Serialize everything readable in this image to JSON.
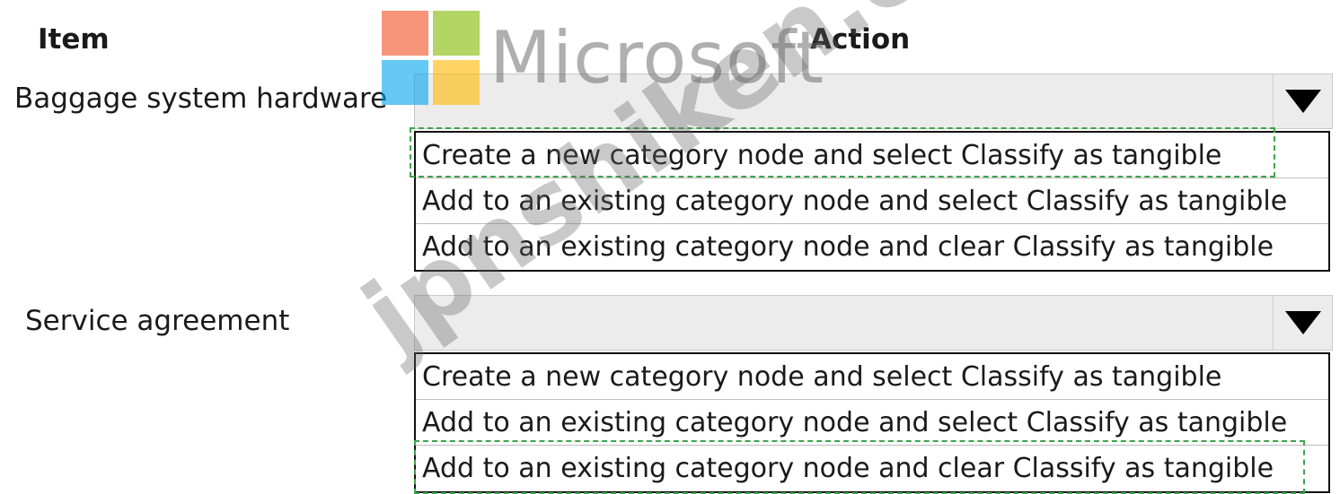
{
  "headers": {
    "item": "Item",
    "action": "Action"
  },
  "rows": [
    {
      "label": "Baggage system hardware",
      "options": [
        "Create a new category node and select Classify as tangible",
        "Add to an existing category node and select Classify as tangible",
        "Add to an existing category node and clear Classify as tangible"
      ],
      "selected_option": "Create a new category node and select Classify as tangible"
    },
    {
      "label": "Service agreement",
      "options": [
        "Create a new category node and select Classify as tangible",
        "Add to an existing category node and select Classify as tangible",
        "Add to an existing category node and clear Classify as tangible"
      ],
      "selected_option": "Add to an existing category node and clear Classify as tangible"
    }
  ],
  "watermarks": {
    "logo": "Microsoft",
    "site": "jpnshiken.com"
  },
  "colors": {
    "dropdown_bg": "#ececec",
    "selection_dash": "#3fa44a",
    "logo": [
      "#f25022",
      "#7fba00",
      "#00a4ef",
      "#ffb900"
    ]
  },
  "icons": {
    "dropdown": "triangle-down-icon"
  }
}
